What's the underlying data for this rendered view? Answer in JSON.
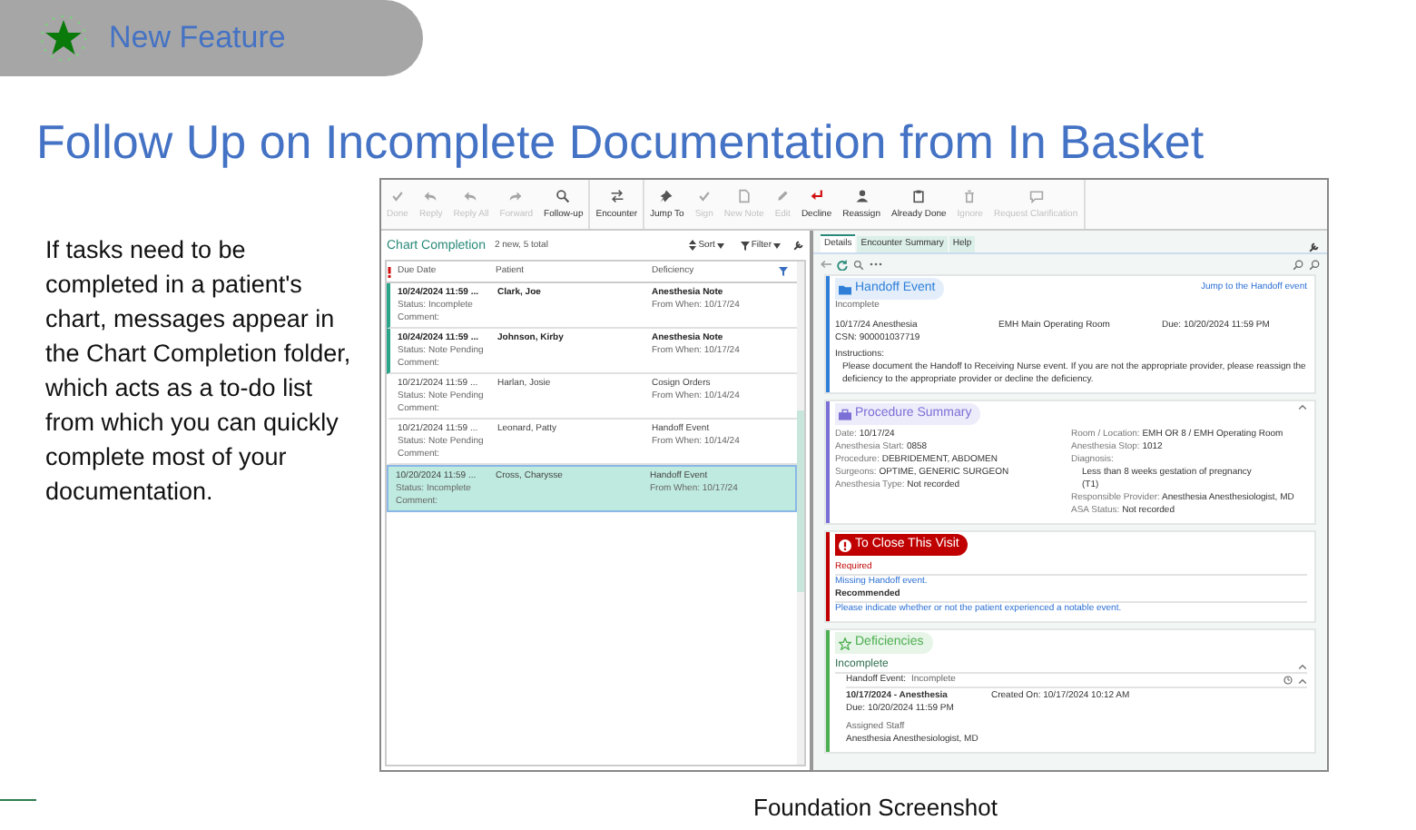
{
  "banner": {
    "label": "New Feature"
  },
  "title": "Follow Up on Incomplete Documentation from In Basket",
  "description": "If tasks need to be completed in a patient's chart, messages appear in the Chart Completion folder, which acts as a to-do list from which you can quickly complete most of your documentation.",
  "screenshot": {
    "toolbar_groups": [
      {
        "buttons": [
          {
            "label": "Done",
            "disabled": true
          },
          {
            "label": "Reply",
            "disabled": true
          },
          {
            "label": "Reply All",
            "disabled": true
          },
          {
            "label": "Forward",
            "disabled": true
          },
          {
            "label": "Follow-up",
            "disabled": false
          }
        ]
      },
      {
        "buttons": [
          {
            "label": "Encounter",
            "disabled": false
          }
        ]
      },
      {
        "buttons": [
          {
            "label": "Jump To",
            "disabled": false
          },
          {
            "label": "Sign",
            "disabled": true
          },
          {
            "label": "New Note",
            "disabled": true
          },
          {
            "label": "Edit",
            "disabled": true
          },
          {
            "label": "Decline",
            "disabled": false
          },
          {
            "label": "Reassign",
            "disabled": false
          },
          {
            "label": "Already Done",
            "disabled": false
          },
          {
            "label": "Ignore",
            "disabled": true
          },
          {
            "label": "Request Clarification",
            "disabled": true
          }
        ]
      }
    ],
    "chart_completion": {
      "title": "Chart Completion",
      "count": "2 new, 5 total",
      "sort": "Sort",
      "filter": "Filter",
      "columns": [
        "Due Date",
        "Patient",
        "Deficiency"
      ],
      "rows": [
        {
          "due": "10/24/2024 11:59 ...",
          "status": "Status: Incomplete",
          "comment": "Comment:",
          "patient": "Clark, Joe",
          "deficiency": "Anesthesia Note",
          "from": "From When: 10/17/24",
          "new": true,
          "selected": false
        },
        {
          "due": "10/24/2024 11:59 ...",
          "status": "Status: Note Pending",
          "comment": "Comment:",
          "patient": "Johnson, Kirby",
          "deficiency": "Anesthesia Note",
          "from": "From When: 10/17/24",
          "new": true,
          "selected": false
        },
        {
          "due": "10/21/2024 11:59 ...",
          "status": "Status: Note Pending",
          "comment": "Comment:",
          "patient": "Harlan, Josie",
          "deficiency": "Cosign Orders",
          "from": "From When: 10/14/24",
          "new": false,
          "selected": false
        },
        {
          "due": "10/21/2024 11:59 ...",
          "status": "Status: Note Pending",
          "comment": "Comment:",
          "patient": "Leonard, Patty",
          "deficiency": "Handoff Event",
          "from": "From When: 10/14/24",
          "new": false,
          "selected": false
        },
        {
          "due": "10/20/2024 11:59 ...",
          "status": "Status: Incomplete",
          "comment": "Comment:",
          "patient": "Cross, Charysse",
          "deficiency": "Handoff Event",
          "from": "From When: 10/17/24",
          "new": false,
          "selected": true
        }
      ]
    },
    "detail_tabs": [
      {
        "label": "Details",
        "selected": true
      },
      {
        "label": "Encounter Summary",
        "selected": false
      },
      {
        "label": "Help",
        "selected": false
      }
    ],
    "cards": [
      {
        "kind": "handoff",
        "title": "Handoff Event",
        "color": "#2f7fd8",
        "link": "Jump to the Handoff event",
        "status": "Incomplete",
        "encounter": "10/17/24 Anesthesia",
        "location": "EMH Main Operating Room",
        "due": "Due: 10/20/2024 11:59 PM",
        "csn": "CSN: 900001037719",
        "instructions_label": "Instructions:",
        "instructions": "Please document the Handoff to Receiving Nurse event. If you are not the appropriate provider, please reassign the deficiency to the appropriate provider or decline the deficiency."
      },
      {
        "kind": "procedure",
        "title": "Procedure Summary",
        "color": "#7b6fd6",
        "left_fields": [
          {
            "label": "Date:",
            "value": "10/17/24"
          },
          {
            "label": "Anesthesia Start:",
            "value": "0858"
          },
          {
            "label": "Procedure:",
            "value": "DEBRIDEMENT, ABDOMEN"
          },
          {
            "label": "Surgeons:",
            "value": "OPTIME, GENERIC SURGEON"
          },
          {
            "label": "Anesthesia Type:",
            "value": "Not recorded"
          }
        ],
        "right_fields": [
          {
            "label": "Room / Location:",
            "value": "EMH OR 8 / EMH Operating Room"
          },
          {
            "label": "Anesthesia Stop:",
            "value": "1012"
          },
          {
            "label": "Diagnosis:",
            "lines": [
              "Less than 8 weeks gestation of pregnancy",
              "(T1)"
            ]
          },
          {
            "label": "Responsible Provider:",
            "value": "Anesthesia Anesthesiologist, MD"
          },
          {
            "label": "ASA Status:",
            "value": "Not recorded"
          }
        ]
      },
      {
        "kind": "close_visit",
        "title": "To Close This Visit",
        "color": "#c00000",
        "required_label": "Required",
        "required_link": "Missing Handoff event.",
        "recommended_label": "Recommended",
        "recommended_link": "Please indicate whether or not the patient experienced a notable event."
      },
      {
        "kind": "deficiencies",
        "title": "Deficiencies",
        "color": "#4caf50",
        "group": "Incomplete",
        "item_title": "Handoff Event:",
        "item_status": "Incomplete",
        "encounter": "10/17/2024 - Anesthesia",
        "created": "Created On: 10/17/2024 10:12 AM",
        "due": "Due: 10/20/2024 11:59 PM",
        "staff_label": "Assigned Staff",
        "staff": "Anesthesia Anesthesiologist, MD"
      }
    ]
  },
  "caption": "Foundation Screenshot"
}
